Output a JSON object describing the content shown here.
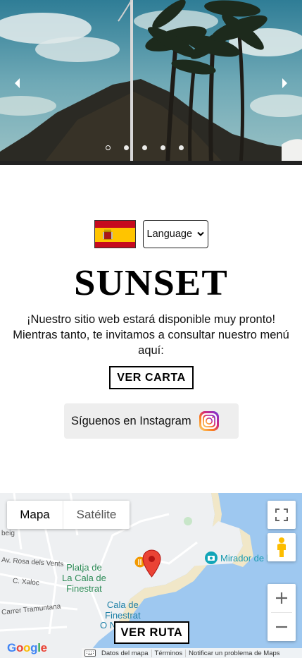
{
  "hero": {
    "slide_count": 5,
    "active_slide": 1,
    "icons": {
      "prev": "chevron-left-icon",
      "next": "chevron-right-icon"
    }
  },
  "language": {
    "flag": "spain-flag",
    "select_value": "Language"
  },
  "brand": {
    "name": "SUNSET"
  },
  "message": {
    "text": "¡Nuestro sitio web estará disponible muy pronto! Mientras tanto, te invitamos a consultar nuestro menú aquí:"
  },
  "buttons": {
    "menu_label": "VER CARTA",
    "route_label": "VER RUTA"
  },
  "instagram": {
    "label": "Síguenos en Instagram",
    "icon": "instagram-icon"
  },
  "map": {
    "type_map": "Mapa",
    "type_satellite": "Satélite",
    "places": {
      "street_1": "Av. Rosa dels Vents",
      "street_2": "C. Xaloc",
      "street_3": "Carrer Tramuntana",
      "street_4": "beig",
      "beach": "Platja de\nLa Cala de\nFinestrat",
      "cala": "Cala de\nFinestrat",
      "cala_cut": "O N",
      "mirador": "Mirador de la Cala"
    },
    "google_logo": "Google",
    "attribution": {
      "map_data": "Datos del mapa",
      "terms": "Términos",
      "report": "Notificar un problema de Maps"
    },
    "colors": {
      "water": "#9ec8f0",
      "land": "#eef0f2",
      "beach": "#f1e7c8",
      "pin": "#ea4335"
    }
  }
}
